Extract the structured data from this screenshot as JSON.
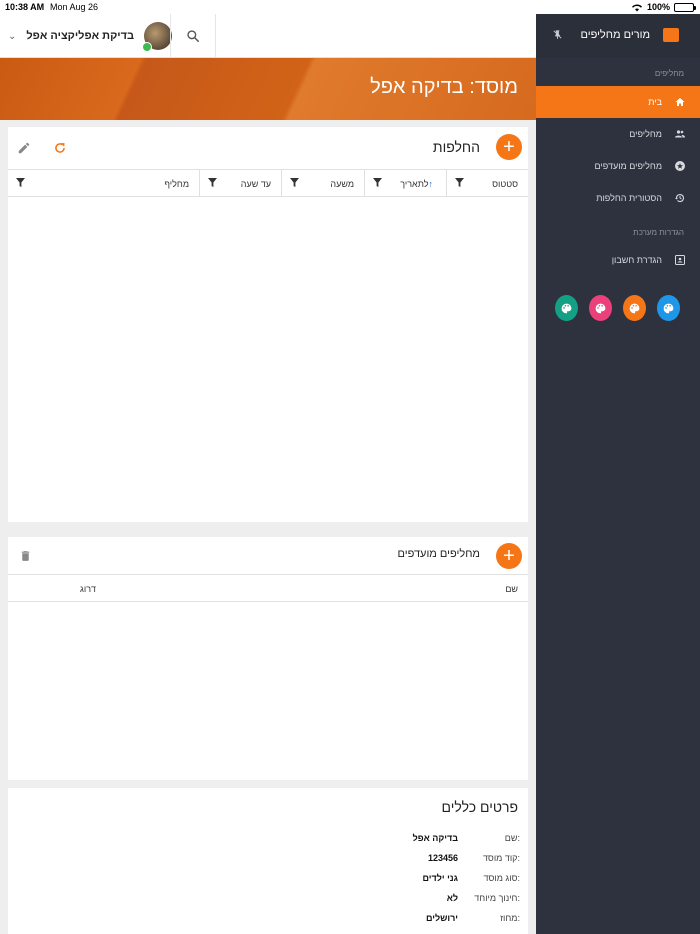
{
  "statusbar": {
    "time": "10:38 AM",
    "date": "Mon Aug 26",
    "battery": "100%"
  },
  "topbar": {
    "username": "בדיקת אפליקציה אפל"
  },
  "banner": {
    "title": "מוסד: בדיקה אפל"
  },
  "substitutions": {
    "title": "החלפות",
    "columns": [
      {
        "label": "סטטוס"
      },
      {
        "label": "לתאריך",
        "sort": "asc"
      },
      {
        "label": "משעה"
      },
      {
        "label": "עד שעה"
      },
      {
        "label": "מחליף"
      }
    ]
  },
  "preferred": {
    "title": "מחליפים מועדפים",
    "columns": [
      {
        "label": "שם"
      },
      {
        "label": "דרוג"
      }
    ]
  },
  "details": {
    "title": "פרטים כללים",
    "rows": [
      {
        "label": "שם:",
        "value": "בדיקה אפל"
      },
      {
        "label": "קוד מוסד:",
        "value": "123456"
      },
      {
        "label": "סוג מוסד:",
        "value": "גני ילדים"
      },
      {
        "label": "חינוך מיוחד:",
        "value": "לא"
      },
      {
        "label": "מחוז:",
        "value": "ירושלים"
      }
    ]
  },
  "sidebar": {
    "app_name": "מורים מחליפים",
    "section_main": "מחליפים",
    "items": [
      {
        "label": "בית",
        "icon": "home-icon"
      },
      {
        "label": "מחליפים",
        "icon": "people-icon"
      },
      {
        "label": "מחליפים מועדפים",
        "icon": "star-icon"
      },
      {
        "label": "הסטורית החלפות",
        "icon": "history-icon"
      }
    ],
    "section_settings": "הגדרות מערכת",
    "settings_item": {
      "label": "הגדרת חשבון",
      "icon": "account-box-icon"
    },
    "theme_colors": [
      "#1e97e8",
      "#f47616",
      "#ec407a",
      "#14a085"
    ]
  },
  "colors": {
    "accent": "#f47616",
    "sidebar_bg": "#2e323e",
    "sort_arrow": "#1e63c8"
  }
}
